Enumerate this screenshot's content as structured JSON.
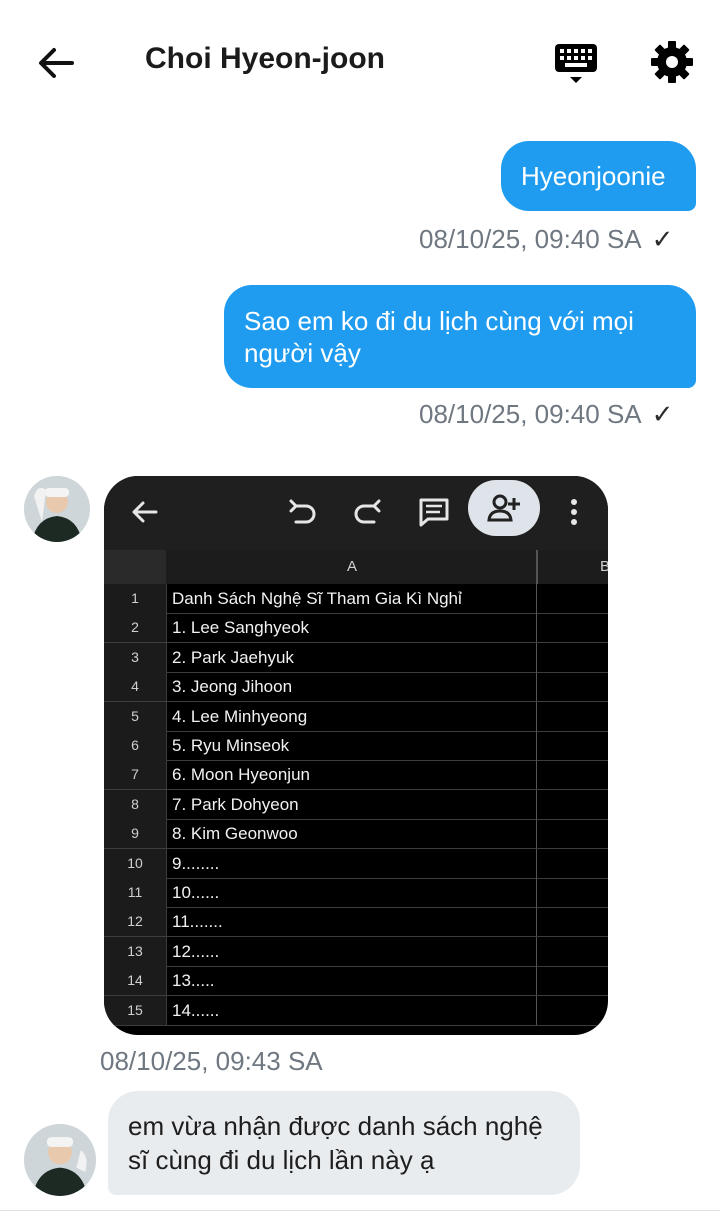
{
  "header": {
    "title": "Choi Hyeon-joon"
  },
  "messages": [
    {
      "from": "me",
      "text": "Hyeonjoonie",
      "time": "08/10/25, 09:40 SA",
      "status": "✓"
    },
    {
      "from": "me",
      "text": "Sao em ko đi du lịch cùng với mọi người vậy",
      "time": "08/10/25, 09:40 SA",
      "status": "✓"
    },
    {
      "from": "them",
      "time": "08/10/25, 09:43 SA",
      "image": {
        "column_a": "A",
        "column_b": "B",
        "rows": [
          {
            "n": "1",
            "text": "Danh Sách Nghệ Sĩ Tham Gia Kì Nghỉ"
          },
          {
            "n": "2",
            "text": "1. Lee Sanghyeok"
          },
          {
            "n": "3",
            "text": "2. Park Jaehyuk"
          },
          {
            "n": "4",
            "text": "3. Jeong Jihoon"
          },
          {
            "n": "5",
            "text": "4. Lee Minhyeong"
          },
          {
            "n": "6",
            "text": "5. Ryu Minseok"
          },
          {
            "n": "7",
            "text": "6. Moon Hyeonjun"
          },
          {
            "n": "8",
            "text": "7. Park Dohyeon"
          },
          {
            "n": "9",
            "text": "8. Kim Geonwoo"
          },
          {
            "n": "10",
            "text": "9........"
          },
          {
            "n": "11",
            "text": "10......"
          },
          {
            "n": "12",
            "text": "11......."
          },
          {
            "n": "13",
            "text": "12......"
          },
          {
            "n": "14",
            "text": "13....."
          },
          {
            "n": "15",
            "text": "14......"
          }
        ]
      }
    },
    {
      "from": "them",
      "text": "em vừa nhận được danh sách nghệ sĩ cùng đi du lịch lần này ạ"
    }
  ],
  "colors": {
    "accent": "#1f9cf0",
    "incoming": "#e9ecef"
  }
}
